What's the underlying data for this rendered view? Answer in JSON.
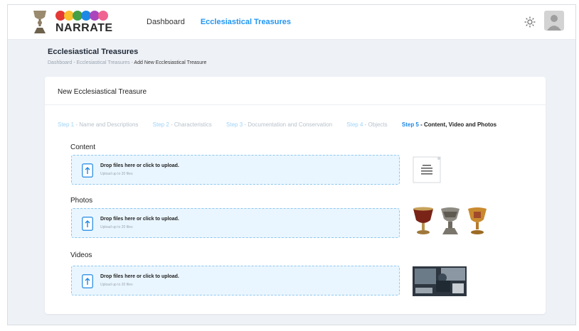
{
  "app": {
    "brand": "NARRATE"
  },
  "nav": {
    "items": [
      {
        "label": "Dashboard"
      },
      {
        "label": "Ecclesiastical Treasures"
      }
    ]
  },
  "header": {
    "title": "Ecclesiastical Treasures",
    "breadcrumb": {
      "part1": "Dashboard",
      "sep": " - ",
      "part2": "Ecclesiastical Treasures",
      "current": "Add New Ecclesiastical Treasure"
    }
  },
  "card": {
    "title": "New Ecclesiastical Treasure",
    "steps": [
      {
        "num": "Step 1",
        "label": " - Name and Descriptions"
      },
      {
        "num": "Step 2",
        "label": " - Characteristics"
      },
      {
        "num": "Step 3",
        "label": " - Documentation and Conservation"
      },
      {
        "num": "Step 4",
        "label": " - Objects"
      },
      {
        "num": "Step 5",
        "label": " - Content, Video and Photos"
      }
    ]
  },
  "sections": {
    "content": {
      "label": "Content",
      "drop_title": "Drop files here or click to upload.",
      "drop_sub": "Upload up to 20 files"
    },
    "photos": {
      "label": "Photos",
      "drop_title": "Drop files here or click to upload.",
      "drop_sub": "Upload up to 20 files"
    },
    "videos": {
      "label": "Videos",
      "drop_title": "Drop files here or click to upload.",
      "drop_sub": "Upload up to 20 files"
    }
  },
  "colors": {
    "accent": "#2196f3",
    "step_inactive": "#b8c2cc",
    "dropzone_bg": "#eaf6ff",
    "dropzone_border": "#8ec7ef",
    "background": "#eef1f6"
  },
  "icons": {
    "theme_toggle": "sun-icon",
    "upload": "upload-icon",
    "user": "avatar"
  }
}
